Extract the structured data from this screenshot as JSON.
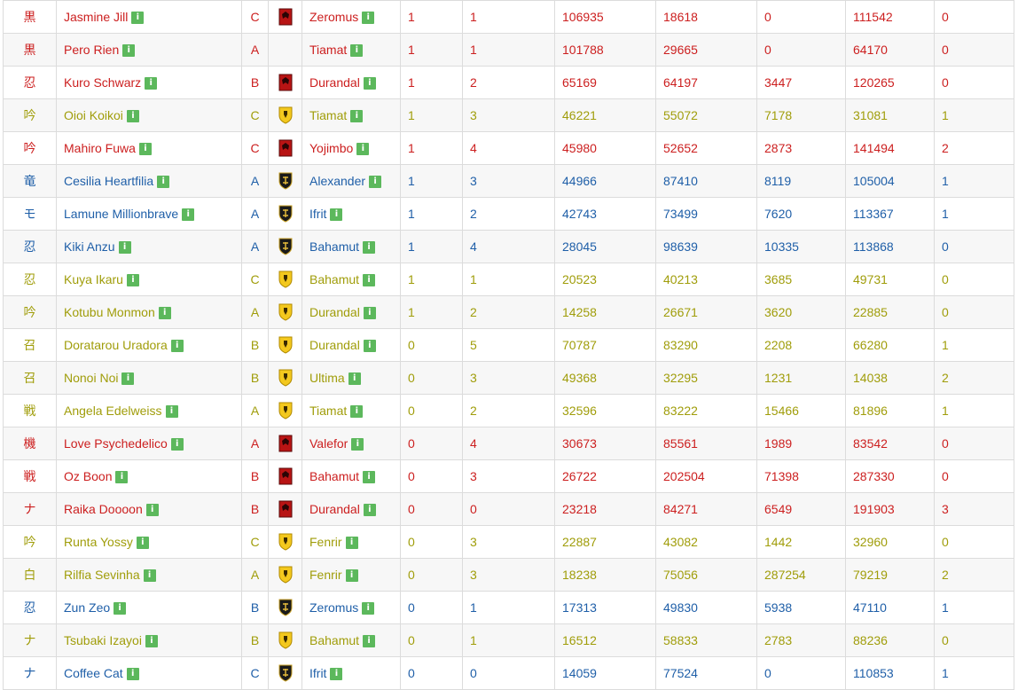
{
  "colors": {
    "red": "#cc1f1f",
    "olive": "#a09d0a",
    "blue": "#1f5fa8",
    "info_badge": "#5cb85c"
  },
  "info_glyph": "i",
  "rows": [
    {
      "job": "黒",
      "name": "Jasmine Jill",
      "rank": "C",
      "emblem": "red-banner-icon",
      "faction": "red",
      "server": "Zeromus",
      "a": "1",
      "b": "1",
      "c": "106935",
      "d": "18618",
      "e": "0",
      "f": "111542",
      "g": "0"
    },
    {
      "job": "黒",
      "name": "Pero Rien",
      "rank": "A",
      "emblem": "none",
      "faction": "red",
      "server": "Tiamat",
      "a": "1",
      "b": "1",
      "c": "101788",
      "d": "29665",
      "e": "0",
      "f": "64170",
      "g": "0"
    },
    {
      "job": "忍",
      "name": "Kuro Schwarz",
      "rank": "B",
      "emblem": "red-banner-icon",
      "faction": "red",
      "server": "Durandal",
      "a": "1",
      "b": "2",
      "c": "65169",
      "d": "64197",
      "e": "3447",
      "f": "120265",
      "g": "0"
    },
    {
      "job": "吟",
      "name": "Oioi Koikoi",
      "rank": "C",
      "emblem": "yellow-shield-icon",
      "faction": "olive",
      "server": "Tiamat",
      "a": "1",
      "b": "3",
      "c": "46221",
      "d": "55072",
      "e": "7178",
      "f": "31081",
      "g": "1"
    },
    {
      "job": "吟",
      "name": "Mahiro Fuwa",
      "rank": "C",
      "emblem": "red-banner-icon",
      "faction": "red",
      "server": "Yojimbo",
      "a": "1",
      "b": "4",
      "c": "45980",
      "d": "52652",
      "e": "2873",
      "f": "141494",
      "g": "2"
    },
    {
      "job": "竜",
      "name": "Cesilia Heartfilia",
      "rank": "A",
      "emblem": "black-shield-icon",
      "faction": "blue",
      "server": "Alexander",
      "a": "1",
      "b": "3",
      "c": "44966",
      "d": "87410",
      "e": "8119",
      "f": "105004",
      "g": "1"
    },
    {
      "job": "モ",
      "name": "Lamune Millionbrave",
      "rank": "A",
      "emblem": "black-shield-icon",
      "faction": "blue",
      "server": "Ifrit",
      "a": "1",
      "b": "2",
      "c": "42743",
      "d": "73499",
      "e": "7620",
      "f": "113367",
      "g": "1"
    },
    {
      "job": "忍",
      "name": "Kiki Anzu",
      "rank": "A",
      "emblem": "black-shield-icon",
      "faction": "blue",
      "server": "Bahamut",
      "a": "1",
      "b": "4",
      "c": "28045",
      "d": "98639",
      "e": "10335",
      "f": "113868",
      "g": "0"
    },
    {
      "job": "忍",
      "name": "Kuya Ikaru",
      "rank": "C",
      "emblem": "yellow-shield-icon",
      "faction": "olive",
      "server": "Bahamut",
      "a": "1",
      "b": "1",
      "c": "20523",
      "d": "40213",
      "e": "3685",
      "f": "49731",
      "g": "0"
    },
    {
      "job": "吟",
      "name": "Kotubu Monmon",
      "rank": "A",
      "emblem": "yellow-shield-icon",
      "faction": "olive",
      "server": "Durandal",
      "a": "1",
      "b": "2",
      "c": "14258",
      "d": "26671",
      "e": "3620",
      "f": "22885",
      "g": "0"
    },
    {
      "job": "召",
      "name": "Doratarou Uradora",
      "rank": "B",
      "emblem": "yellow-shield-icon",
      "faction": "olive",
      "server": "Durandal",
      "a": "0",
      "b": "5",
      "c": "70787",
      "d": "83290",
      "e": "2208",
      "f": "66280",
      "g": "1"
    },
    {
      "job": "召",
      "name": "Nonoi Noi",
      "rank": "B",
      "emblem": "yellow-shield-icon",
      "faction": "olive",
      "server": "Ultima",
      "a": "0",
      "b": "3",
      "c": "49368",
      "d": "32295",
      "e": "1231",
      "f": "14038",
      "g": "2"
    },
    {
      "job": "戦",
      "name": "Angela Edelweiss",
      "rank": "A",
      "emblem": "yellow-shield-icon",
      "faction": "olive",
      "server": "Tiamat",
      "a": "0",
      "b": "2",
      "c": "32596",
      "d": "83222",
      "e": "15466",
      "f": "81896",
      "g": "1"
    },
    {
      "job": "機",
      "name": "Love Psychedelico",
      "rank": "A",
      "emblem": "red-banner-icon",
      "faction": "red",
      "server": "Valefor",
      "a": "0",
      "b": "4",
      "c": "30673",
      "d": "85561",
      "e": "1989",
      "f": "83542",
      "g": "0"
    },
    {
      "job": "戦",
      "name": "Oz Boon",
      "rank": "B",
      "emblem": "red-banner-icon",
      "faction": "red",
      "server": "Bahamut",
      "a": "0",
      "b": "3",
      "c": "26722",
      "d": "202504",
      "e": "71398",
      "f": "287330",
      "g": "0"
    },
    {
      "job": "ナ",
      "name": "Raika Doooon",
      "rank": "B",
      "emblem": "red-banner-icon",
      "faction": "red",
      "server": "Durandal",
      "a": "0",
      "b": "0",
      "c": "23218",
      "d": "84271",
      "e": "6549",
      "f": "191903",
      "g": "3"
    },
    {
      "job": "吟",
      "name": "Runta Yossy",
      "rank": "C",
      "emblem": "yellow-shield-icon",
      "faction": "olive",
      "server": "Fenrir",
      "a": "0",
      "b": "3",
      "c": "22887",
      "d": "43082",
      "e": "1442",
      "f": "32960",
      "g": "0"
    },
    {
      "job": "白",
      "name": "Rilfia Sevinha",
      "rank": "A",
      "emblem": "yellow-shield-icon",
      "faction": "olive",
      "server": "Fenrir",
      "a": "0",
      "b": "3",
      "c": "18238",
      "d": "75056",
      "e": "287254",
      "f": "79219",
      "g": "2"
    },
    {
      "job": "忍",
      "name": "Zun Zeo",
      "rank": "B",
      "emblem": "black-shield-icon",
      "faction": "blue",
      "server": "Zeromus",
      "a": "0",
      "b": "1",
      "c": "17313",
      "d": "49830",
      "e": "5938",
      "f": "47110",
      "g": "1"
    },
    {
      "job": "ナ",
      "name": "Tsubaki Izayoi",
      "rank": "B",
      "emblem": "yellow-shield-icon",
      "faction": "olive",
      "server": "Bahamut",
      "a": "0",
      "b": "1",
      "c": "16512",
      "d": "58833",
      "e": "2783",
      "f": "88236",
      "g": "0"
    },
    {
      "job": "ナ",
      "name": "Coffee Cat",
      "rank": "C",
      "emblem": "black-shield-icon",
      "faction": "blue",
      "server": "Ifrit",
      "a": "0",
      "b": "0",
      "c": "14059",
      "d": "77524",
      "e": "0",
      "f": "110853",
      "g": "1"
    }
  ]
}
